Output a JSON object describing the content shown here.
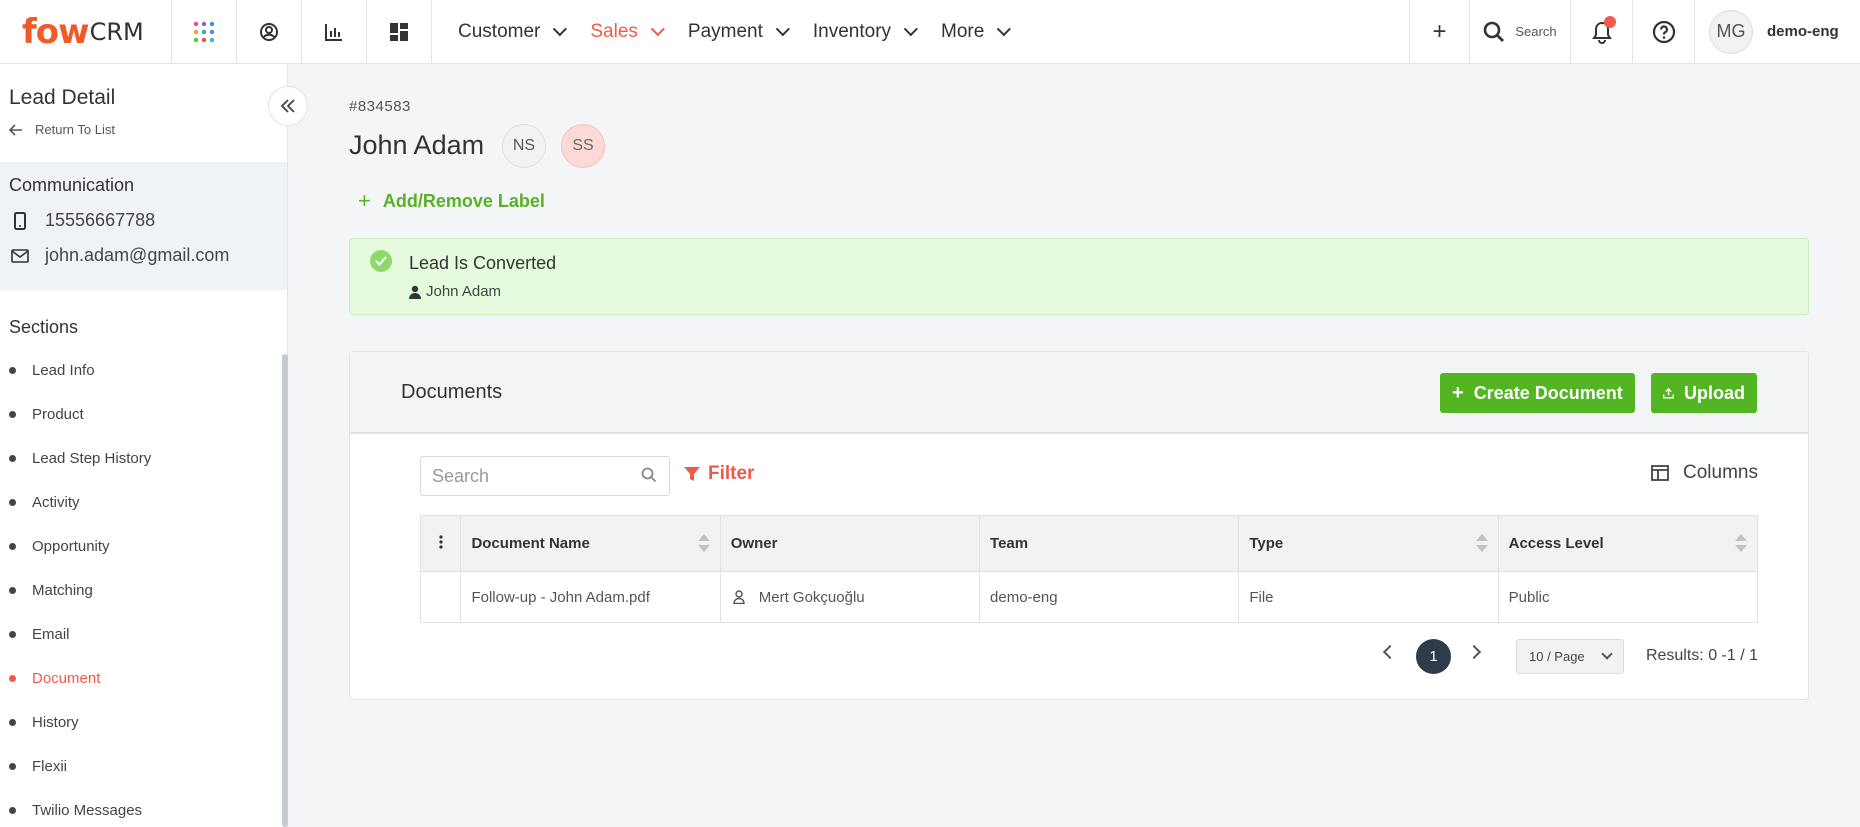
{
  "nav": {
    "logo_brand": "fow",
    "logo_suffix": "CRM",
    "menu": [
      {
        "label": "Customer"
      },
      {
        "label": "Sales"
      },
      {
        "label": "Payment"
      },
      {
        "label": "Inventory"
      },
      {
        "label": "More"
      }
    ],
    "search_label": "Search",
    "user_initials": "MG",
    "user_name": "demo-eng"
  },
  "sidebar": {
    "title": "Lead Detail",
    "return_label": "Return To List",
    "communication_title": "Communication",
    "phone": "15556667788",
    "email": "john.adam@gmail.com",
    "sections_title": "Sections",
    "sections": [
      {
        "label": "Lead Info"
      },
      {
        "label": "Product"
      },
      {
        "label": "Lead Step History"
      },
      {
        "label": "Activity"
      },
      {
        "label": "Opportunity"
      },
      {
        "label": "Matching"
      },
      {
        "label": "Email"
      },
      {
        "label": "Document"
      },
      {
        "label": "History"
      },
      {
        "label": "Flexii"
      },
      {
        "label": "Twilio Messages"
      }
    ]
  },
  "lead": {
    "id": "#834583",
    "name": "John Adam",
    "tags": [
      "NS",
      "SS"
    ],
    "add_label": "Add/Remove Label",
    "status_title": "Lead Is Converted",
    "status_user": "John Adam"
  },
  "documents": {
    "title": "Documents",
    "create_label": "Create Document",
    "upload_label": "Upload",
    "search_placeholder": "Search",
    "filter_label": "Filter",
    "columns_label": "Columns",
    "headers": [
      "Document Name",
      "Owner",
      "Team",
      "Type",
      "Access Level"
    ],
    "rows": [
      {
        "name": "Follow-up - John Adam.pdf",
        "owner": "Mert Gokçuoğlu",
        "team": "demo-eng",
        "type": "File",
        "access": "Public"
      }
    ],
    "page": "1",
    "page_size": "10 / Page",
    "results": "Results: 0 -1 / 1"
  },
  "colors": {
    "accent_red": "#ef5b4b",
    "accent_green": "#52b521",
    "converted_bg": "#e6fbdd"
  }
}
